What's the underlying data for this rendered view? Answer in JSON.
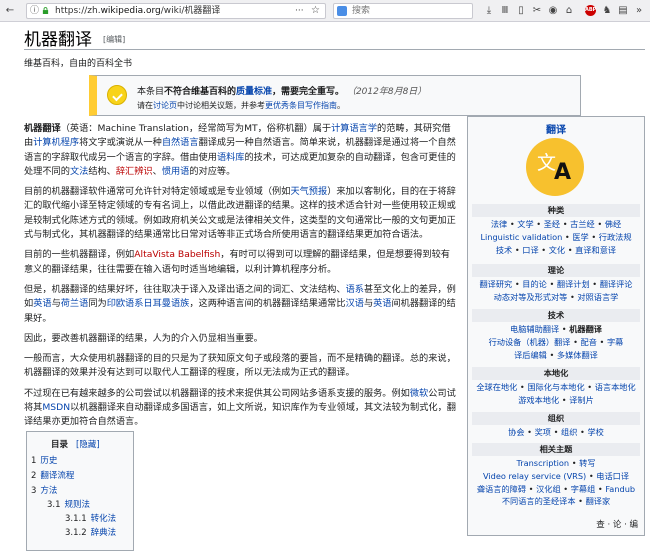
{
  "browser": {
    "url_prefix": "https://zh.",
    "url_domain": "wikipedia.org",
    "url_path": "/wiki/机器翻译",
    "url_more": "···",
    "search_placeholder": "搜索",
    "abp_label": "ABP"
  },
  "article": {
    "title": "机器翻译",
    "edit_link": "[编辑]",
    "tagline": "维基百科，自由的百科全书",
    "notice": {
      "l1a": "本条目",
      "l1b": "不符合维基百科的",
      "l1c": "质量标准",
      "l1d": "，需要完全重写。",
      "date": "（2012年8月8日）",
      "l2a": "请在",
      "l2b": "讨论页",
      "l2c": "中讨论相关议题，并参考",
      "l2d": "更优秀条目写作指南",
      "l2e": "。"
    },
    "p1": {
      "a": "机器翻译",
      "b": "（英语：Machine Translation，经常简写为MT，俗称机翻）属于",
      "c": "计算语言学",
      "d": "的范畴，其研究借由",
      "e": "计算机程序",
      "f": "将文字或演说从一种",
      "g": "自然语言",
      "h": "翻译成另一种自然语言。简单来说，机器翻译是通过将一个自然语言的字辞取代成另一个语言的字辞。借由使用",
      "i": "语料库",
      "j": "的技术，可达成更加复杂的自动翻译，包含可更佳的处理不同的",
      "k": "文法",
      "l": "结构、",
      "m": "辞汇辨识",
      "n": "、",
      "o": "惯用语",
      "p": "的对应等。"
    },
    "p2": {
      "a": "目前的机器翻译软件通常可允许针对特定领域或是专业领域（例如",
      "b": "天气预报",
      "c": "）来加以客制化，目的在于将辞汇的取代缩小译至特定领域的专有名词上，以借此改进翻译的结果。这样的技术适合针对一些使用较正规或是较制式化陈述方式的领域。例如政府机关公文或是法律相关文件，这类型的文句通常比一般的文句更加正式与制式化，其机器翻译的结果通常比日常对话等非正式场合所使用语言的翻译结果更加符合语法。"
    },
    "p3": {
      "a": "目前的一些机器翻译，例如",
      "b": "AltaVista Babelfish",
      "c": "，有时可以得到可以理解的翻译结果，但是想要得到较有意义的翻译结果，往往需要在输入语句时适当地编辑，以利计算机程序分析。"
    },
    "p4": {
      "a": "但是，机器翻译的结果好坏，往往取决于译入及译出语之间的词汇、文法结构、",
      "b": "语系",
      "c": "甚至文化上的差异，例如",
      "d": "英语",
      "e": "与",
      "f": "荷兰语",
      "g": "同为",
      "h": "印欧语系日耳曼语族",
      "i": "，这两种语言间的机器翻译结果通常比",
      "j": "汉语",
      "k": "与",
      "l": "英语",
      "m": "间机器翻译的结果好。"
    },
    "p5": "因此，要改善机器翻译的结果，人为的介入仍显相当重要。",
    "p6": "一般而言，大众使用机器翻译的目的只是为了获知原文句子或段落的要旨，而不是精确的翻译。总的来说，机器翻译的效果并没有达到可以取代人工翻译的程度，所以无法成为正式的翻译。",
    "p7": {
      "a": "不过现在已有越来越多的公司尝试以机器翻译的技术来提供其公司网站多语系支援的服务。例如",
      "b": "微软",
      "c": "公司试将其",
      "d": "MSDN",
      "e": "以机器翻译来自动翻译成多国语言，如上文所说，知识库作为专业领域，其文法较为制式化，翻译结果亦更加符合自然语言。"
    }
  },
  "toc": {
    "heading": "目录",
    "hide": "[隐藏]",
    "items": [
      {
        "num": "1",
        "label": "历史"
      },
      {
        "num": "2",
        "label": "翻译流程"
      },
      {
        "num": "3",
        "label": "方法"
      },
      {
        "num": "3.1",
        "label": "规则法"
      },
      {
        "num": "3.1.1",
        "label": "转化法"
      },
      {
        "num": "3.1.2",
        "label": "辞典法"
      }
    ]
  },
  "navbox": {
    "title": "翻译",
    "logo_wen": "文",
    "logo_a": "A",
    "sections": {
      "types": "种类",
      "theory": "理论",
      "tech": "技术",
      "local": "本地化",
      "org": "组织",
      "related": "相关主题"
    },
    "types_lines": [
      [
        "法律",
        "文学",
        "圣经",
        "古兰经",
        "佛经"
      ],
      [
        "Linguistic validation",
        "医学",
        "行政法规"
      ],
      [
        "技术",
        "口译",
        "文化",
        "直译和意译"
      ]
    ],
    "theory_lines": [
      [
        "翻译研究",
        "目的论",
        "翻译计划",
        "翻译评论"
      ],
      [
        "动态对等及形式对等",
        "对照语言学"
      ]
    ],
    "tech_lines": [
      [
        "电脑辅助翻译",
        "机器翻译"
      ],
      [
        "行动设备（机器）翻译",
        "配音",
        "字幕"
      ],
      [
        "译后编辑",
        "多媒体翻译"
      ]
    ],
    "local_lines": [
      [
        "全球在地化",
        "国际化与本地化",
        "语言本地化"
      ],
      [
        "游戏本地化",
        "译制片"
      ]
    ],
    "org_lines": [
      [
        "协会",
        "奖项",
        "组织",
        "学校"
      ]
    ],
    "related_lines": [
      [
        "Transcription",
        "转写"
      ],
      [
        "Video relay service (VRS)",
        "电话口译"
      ],
      [
        "聋语言的障碍",
        "汉化组",
        "字幕组",
        "Fandub"
      ],
      [
        "不同语言的圣经译本",
        "翻译家"
      ]
    ],
    "footer": "查 · 论 · 编"
  }
}
